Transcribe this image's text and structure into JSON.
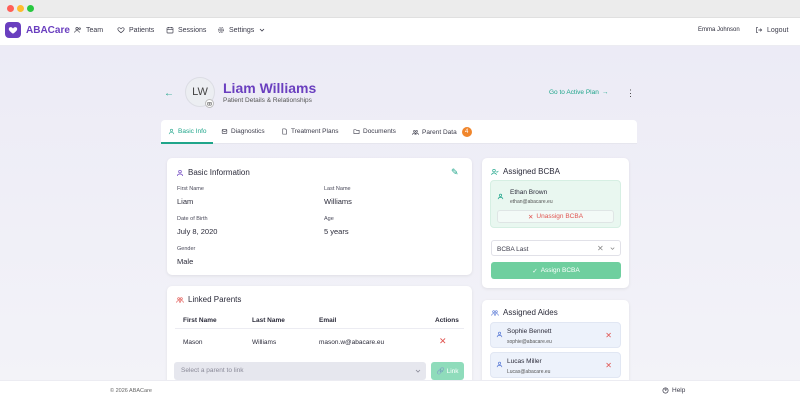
{
  "app": {
    "name": "ABACare",
    "brand_color": "#6a3fbf",
    "accent_color": "#1fa58a"
  },
  "nav": {
    "items": [
      {
        "label": "Team",
        "icon": "team-icon"
      },
      {
        "label": "Patients",
        "icon": "heart-icon"
      },
      {
        "label": "Sessions",
        "icon": "calendar-icon"
      },
      {
        "label": "Settings",
        "icon": "gear-icon"
      }
    ],
    "user_name": "Emma Johnson",
    "logout_label": "Logout"
  },
  "patient": {
    "initials": "LW",
    "name": "Liam Williams",
    "subtitle": "Patient Details & Relationships",
    "goto_label": "Go to Active Plan"
  },
  "tabs": [
    {
      "label": "Basic Info",
      "active": true
    },
    {
      "label": "Diagnostics"
    },
    {
      "label": "Treatment Plans"
    },
    {
      "label": "Documents"
    },
    {
      "label": "Parent Data",
      "badge": "4"
    }
  ],
  "basic_info": {
    "title": "Basic Information",
    "first_name_label": "First Name",
    "first_name": "Liam",
    "last_name_label": "Last Name",
    "last_name": "Williams",
    "dob_label": "Date of Birth",
    "dob": "July 8, 2020",
    "age_label": "Age",
    "age": "5 years",
    "gender_label": "Gender",
    "gender": "Male"
  },
  "linked_parents": {
    "title": "Linked Parents",
    "columns": [
      "First Name",
      "Last Name",
      "Email",
      "Actions"
    ],
    "rows": [
      {
        "first": "Mason",
        "last": "Williams",
        "email": "mason.w@abacare.eu"
      }
    ],
    "select_placeholder": "Select a parent to link",
    "link_label": "Link"
  },
  "bcba": {
    "title": "Assigned BCBA",
    "name": "Ethan Brown",
    "email": "ethan@abacare.eu",
    "unassign_label": "Unassign BCBA",
    "select_value": "BCBA Last",
    "assign_label": "Assign BCBA"
  },
  "aides": {
    "title": "Assigned Aides",
    "items": [
      {
        "name": "Sophie Bennett",
        "email": "sophie@abacare.eu"
      },
      {
        "name": "Lucas Miller",
        "email": "Lucas@abacare.eu"
      }
    ]
  },
  "footer": {
    "copyright": "© 2026 ABACare",
    "help_label": "Help"
  }
}
